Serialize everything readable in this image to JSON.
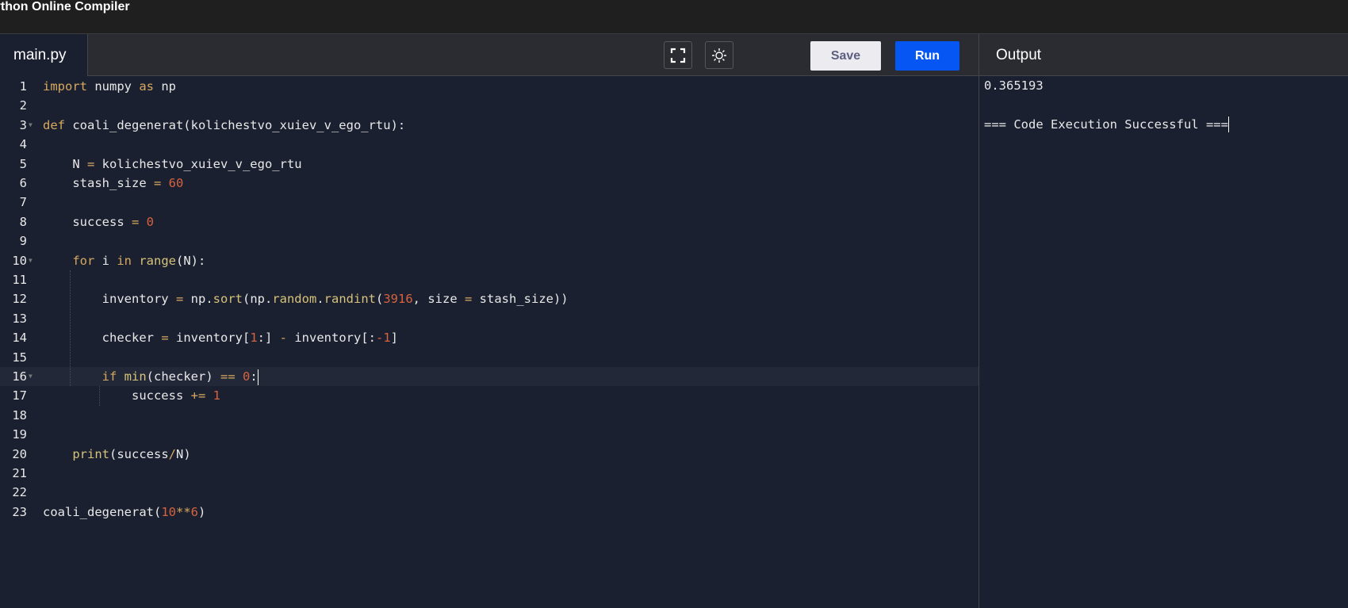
{
  "app_title": "ython Online Compiler",
  "tab": "main.py",
  "toolbar": {
    "fullscreen_icon": "fullscreen-icon",
    "theme_icon": "sun-icon",
    "save_label": "Save",
    "run_label": "Run"
  },
  "output": {
    "label": "Output",
    "lines": [
      "0.365193",
      "",
      "=== Code Execution Successful ==="
    ]
  },
  "colors": {
    "run": "#0556f3",
    "editor_bg": "#1b2030",
    "keyword": "#d6a95f",
    "number": "#d6623f"
  },
  "active_line": 16,
  "code": [
    {
      "n": "1",
      "t": [
        [
          "kw",
          "import"
        ],
        [
          "tx",
          " numpy "
        ],
        [
          "kw",
          "as"
        ],
        [
          "tx",
          " np"
        ]
      ]
    },
    {
      "n": "2",
      "t": []
    },
    {
      "n": "3",
      "fold": true,
      "t": [
        [
          "kw",
          "def"
        ],
        [
          "tx",
          " coali_degenerat(kolichestvo_xuiev_v_ego_rtu):"
        ]
      ]
    },
    {
      "n": "4",
      "t": []
    },
    {
      "n": "5",
      "t": [
        [
          "tx",
          "    N "
        ],
        [
          "op",
          "="
        ],
        [
          "tx",
          " kolichestvo_xuiev_v_ego_rtu"
        ]
      ]
    },
    {
      "n": "6",
      "t": [
        [
          "tx",
          "    stash_size "
        ],
        [
          "op",
          "="
        ],
        [
          "tx",
          " "
        ],
        [
          "num",
          "60"
        ]
      ]
    },
    {
      "n": "7",
      "t": []
    },
    {
      "n": "8",
      "t": [
        [
          "tx",
          "    success "
        ],
        [
          "op",
          "="
        ],
        [
          "tx",
          " "
        ],
        [
          "num",
          "0"
        ]
      ]
    },
    {
      "n": "9",
      "t": []
    },
    {
      "n": "10",
      "fold": true,
      "t": [
        [
          "tx",
          "    "
        ],
        [
          "kw",
          "for"
        ],
        [
          "tx",
          " i "
        ],
        [
          "kw",
          "in"
        ],
        [
          "tx",
          " "
        ],
        [
          "fn",
          "range"
        ],
        [
          "tx",
          "(N):"
        ]
      ]
    },
    {
      "n": "11",
      "t": []
    },
    {
      "n": "12",
      "t": [
        [
          "tx",
          "        inventory "
        ],
        [
          "op",
          "="
        ],
        [
          "tx",
          " np."
        ],
        [
          "fn",
          "sort"
        ],
        [
          "tx",
          "(np."
        ],
        [
          "fn",
          "random"
        ],
        [
          "tx",
          "."
        ],
        [
          "fn",
          "randint"
        ],
        [
          "tx",
          "("
        ],
        [
          "num",
          "3916"
        ],
        [
          "tx",
          ", size "
        ],
        [
          "op",
          "="
        ],
        [
          "tx",
          " stash_size))"
        ]
      ]
    },
    {
      "n": "13",
      "t": []
    },
    {
      "n": "14",
      "t": [
        [
          "tx",
          "        checker "
        ],
        [
          "op",
          "="
        ],
        [
          "tx",
          " inventory["
        ],
        [
          "num",
          "1"
        ],
        [
          "tx",
          ":] "
        ],
        [
          "op",
          "-"
        ],
        [
          "tx",
          " inventory[:"
        ],
        [
          "num",
          "-1"
        ],
        [
          "tx",
          "]"
        ]
      ]
    },
    {
      "n": "15",
      "t": []
    },
    {
      "n": "16",
      "fold": true,
      "t": [
        [
          "tx",
          "        "
        ],
        [
          "kw",
          "if"
        ],
        [
          "tx",
          " "
        ],
        [
          "fn",
          "min"
        ],
        [
          "tx",
          "(checker) "
        ],
        [
          "op",
          "=="
        ],
        [
          "tx",
          " "
        ],
        [
          "num",
          "0"
        ],
        [
          "tx",
          ":"
        ]
      ]
    },
    {
      "n": "17",
      "t": [
        [
          "tx",
          "            success "
        ],
        [
          "op",
          "+="
        ],
        [
          "tx",
          " "
        ],
        [
          "num",
          "1"
        ]
      ]
    },
    {
      "n": "18",
      "t": []
    },
    {
      "n": "19",
      "t": []
    },
    {
      "n": "20",
      "t": [
        [
          "tx",
          "    "
        ],
        [
          "fn",
          "print"
        ],
        [
          "tx",
          "(success"
        ],
        [
          "op",
          "/"
        ],
        [
          "tx",
          "N)"
        ]
      ]
    },
    {
      "n": "21",
      "t": []
    },
    {
      "n": "22",
      "t": []
    },
    {
      "n": "23",
      "t": [
        [
          "tx",
          "coali_degenerat("
        ],
        [
          "num",
          "10"
        ],
        [
          "op",
          "**"
        ],
        [
          "num",
          "6"
        ],
        [
          "tx",
          ")"
        ]
      ]
    }
  ]
}
